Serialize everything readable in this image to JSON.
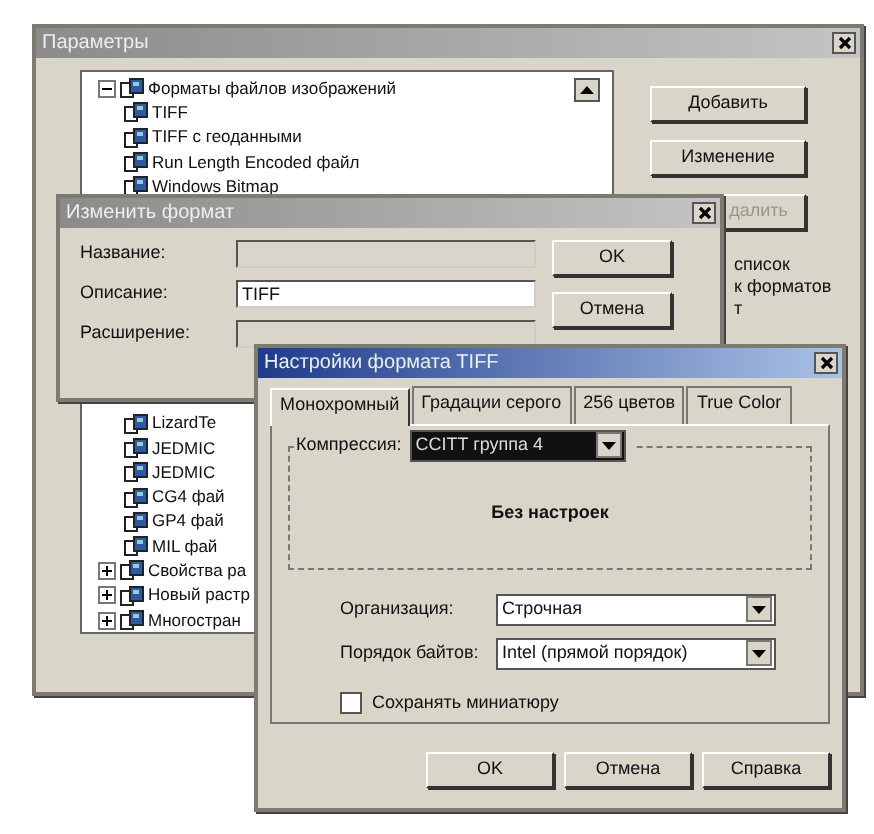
{
  "main_window": {
    "title": "Параметры",
    "tree": [
      {
        "label": "Форматы файлов изображений",
        "expanded": true,
        "children": [
          {
            "label": "TIFF"
          },
          {
            "label": "TIFF с геоданными"
          },
          {
            "label": "Run Length Encoded файл"
          },
          {
            "label": "Windows Bitmap"
          },
          {
            "label": "LizardTe"
          },
          {
            "label": "JEDMIC"
          },
          {
            "label": "JEDMIC"
          },
          {
            "label": "CG4 фай"
          },
          {
            "label": "GP4 фай"
          },
          {
            "label": "MIL фай"
          }
        ]
      },
      {
        "label": "Свойства ра",
        "expanded": false
      },
      {
        "label": "Новый растр",
        "expanded": false
      },
      {
        "label": "Многостран",
        "expanded": false
      }
    ],
    "buttons": [
      {
        "label": "Добавить",
        "disabled": false
      },
      {
        "label": "Изменение",
        "disabled": false
      },
      {
        "label": "далить",
        "disabled": true
      }
    ],
    "note_lines": [
      "список",
      "к форматов",
      "т"
    ]
  },
  "edit_dialog": {
    "title": "Изменить формат",
    "fields": [
      {
        "label": "Название:",
        "disabled": true
      },
      {
        "label": "Описание:",
        "value": "TIFF",
        "disabled": false
      },
      {
        "label": "Расширение:",
        "disabled": true
      }
    ],
    "buttons": [
      "OK",
      "Отмена"
    ]
  },
  "tiff_dialog": {
    "title": "Настройки формата TIFF",
    "tabs": [
      {
        "label": "Монохромный",
        "selected": true
      },
      {
        "label": "Градации серого",
        "selected": false
      },
      {
        "label": "256 цветов",
        "selected": false
      },
      {
        "label": "True Color",
        "selected": false
      }
    ],
    "compression": {
      "label": "Компрессия:",
      "value": "CCITT группа 4",
      "message": "Без настроек"
    },
    "fields": [
      {
        "label": "Организация:",
        "value": "Строчная"
      },
      {
        "label": "Порядок байтов:",
        "value": "Intel (прямой порядок)"
      }
    ],
    "checkbox": {
      "label": "Сохранять миниатюру",
      "checked": false
    },
    "buttons": [
      "OK",
      "Отмена",
      "Справка"
    ]
  }
}
